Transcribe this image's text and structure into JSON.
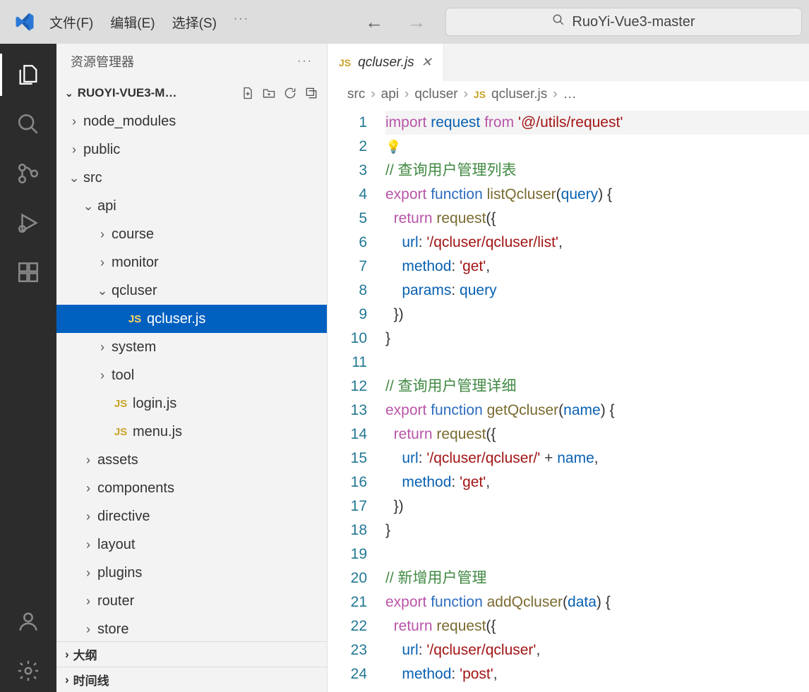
{
  "title_search": "RuoYi-Vue3-master",
  "menu": {
    "file": "文件(F)",
    "edit": "编辑(E)",
    "select": "选择(S)"
  },
  "sidebar": {
    "title": "资源管理器",
    "project": "RUOYI-VUE3-M…",
    "outline": "大纲",
    "timeline": "时间线"
  },
  "tree": [
    {
      "d": 0,
      "t": "folder",
      "open": false,
      "label": "node_modules"
    },
    {
      "d": 0,
      "t": "folder",
      "open": false,
      "label": "public"
    },
    {
      "d": 0,
      "t": "folder",
      "open": true,
      "label": "src"
    },
    {
      "d": 1,
      "t": "folder",
      "open": true,
      "label": "api"
    },
    {
      "d": 2,
      "t": "folder",
      "open": false,
      "label": "course"
    },
    {
      "d": 2,
      "t": "folder",
      "open": false,
      "label": "monitor"
    },
    {
      "d": 2,
      "t": "folder",
      "open": true,
      "label": "qcluser"
    },
    {
      "d": 3,
      "t": "jsfile",
      "label": "qcluser.js",
      "selected": true
    },
    {
      "d": 2,
      "t": "folder",
      "open": false,
      "label": "system"
    },
    {
      "d": 2,
      "t": "folder",
      "open": false,
      "label": "tool"
    },
    {
      "d": 2,
      "t": "jsfile",
      "label": "login.js"
    },
    {
      "d": 2,
      "t": "jsfile",
      "label": "menu.js"
    },
    {
      "d": 1,
      "t": "folder",
      "open": false,
      "label": "assets"
    },
    {
      "d": 1,
      "t": "folder",
      "open": false,
      "label": "components"
    },
    {
      "d": 1,
      "t": "folder",
      "open": false,
      "label": "directive"
    },
    {
      "d": 1,
      "t": "folder",
      "open": false,
      "label": "layout"
    },
    {
      "d": 1,
      "t": "folder",
      "open": false,
      "label": "plugins"
    },
    {
      "d": 1,
      "t": "folder",
      "open": false,
      "label": "router"
    },
    {
      "d": 1,
      "t": "folder",
      "open": false,
      "label": "store"
    }
  ],
  "tab": {
    "icon": "JS",
    "name": "qcluser.js"
  },
  "breadcrumb": [
    "src",
    "api",
    "qcluser",
    "qcluser.js",
    "…"
  ],
  "code_lines": 24,
  "code": {
    "l1_import": "import",
    "l1_req": "request",
    "l1_from": "from",
    "l1_str": "'@/utils/request'",
    "l3_cmt": "// 查询用户管理列表",
    "l4_export": "export",
    "l4_function": "function",
    "l4_fn": "listQcluser",
    "l4_prm": "query",
    "l5_return": "return",
    "l5_req": "request",
    "l6_url": "url",
    "l6_str": "'/qcluser/qcluser/list'",
    "l7_method": "method",
    "l7_str": "'get'",
    "l8_params": "params",
    "l8_val": "query",
    "l12_cmt": "// 查询用户管理详细",
    "l13_fn": "getQcluser",
    "l13_prm": "name",
    "l15_str": "'/qcluser/qcluser/'",
    "l15_plus": " + ",
    "l15_name": "name",
    "l16_str": "'get'",
    "l20_cmt": "// 新增用户管理",
    "l21_fn": "addQcluser",
    "l21_prm": "data",
    "l23_str": "'/qcluser/qcluser'",
    "l24_str": "'post'"
  }
}
